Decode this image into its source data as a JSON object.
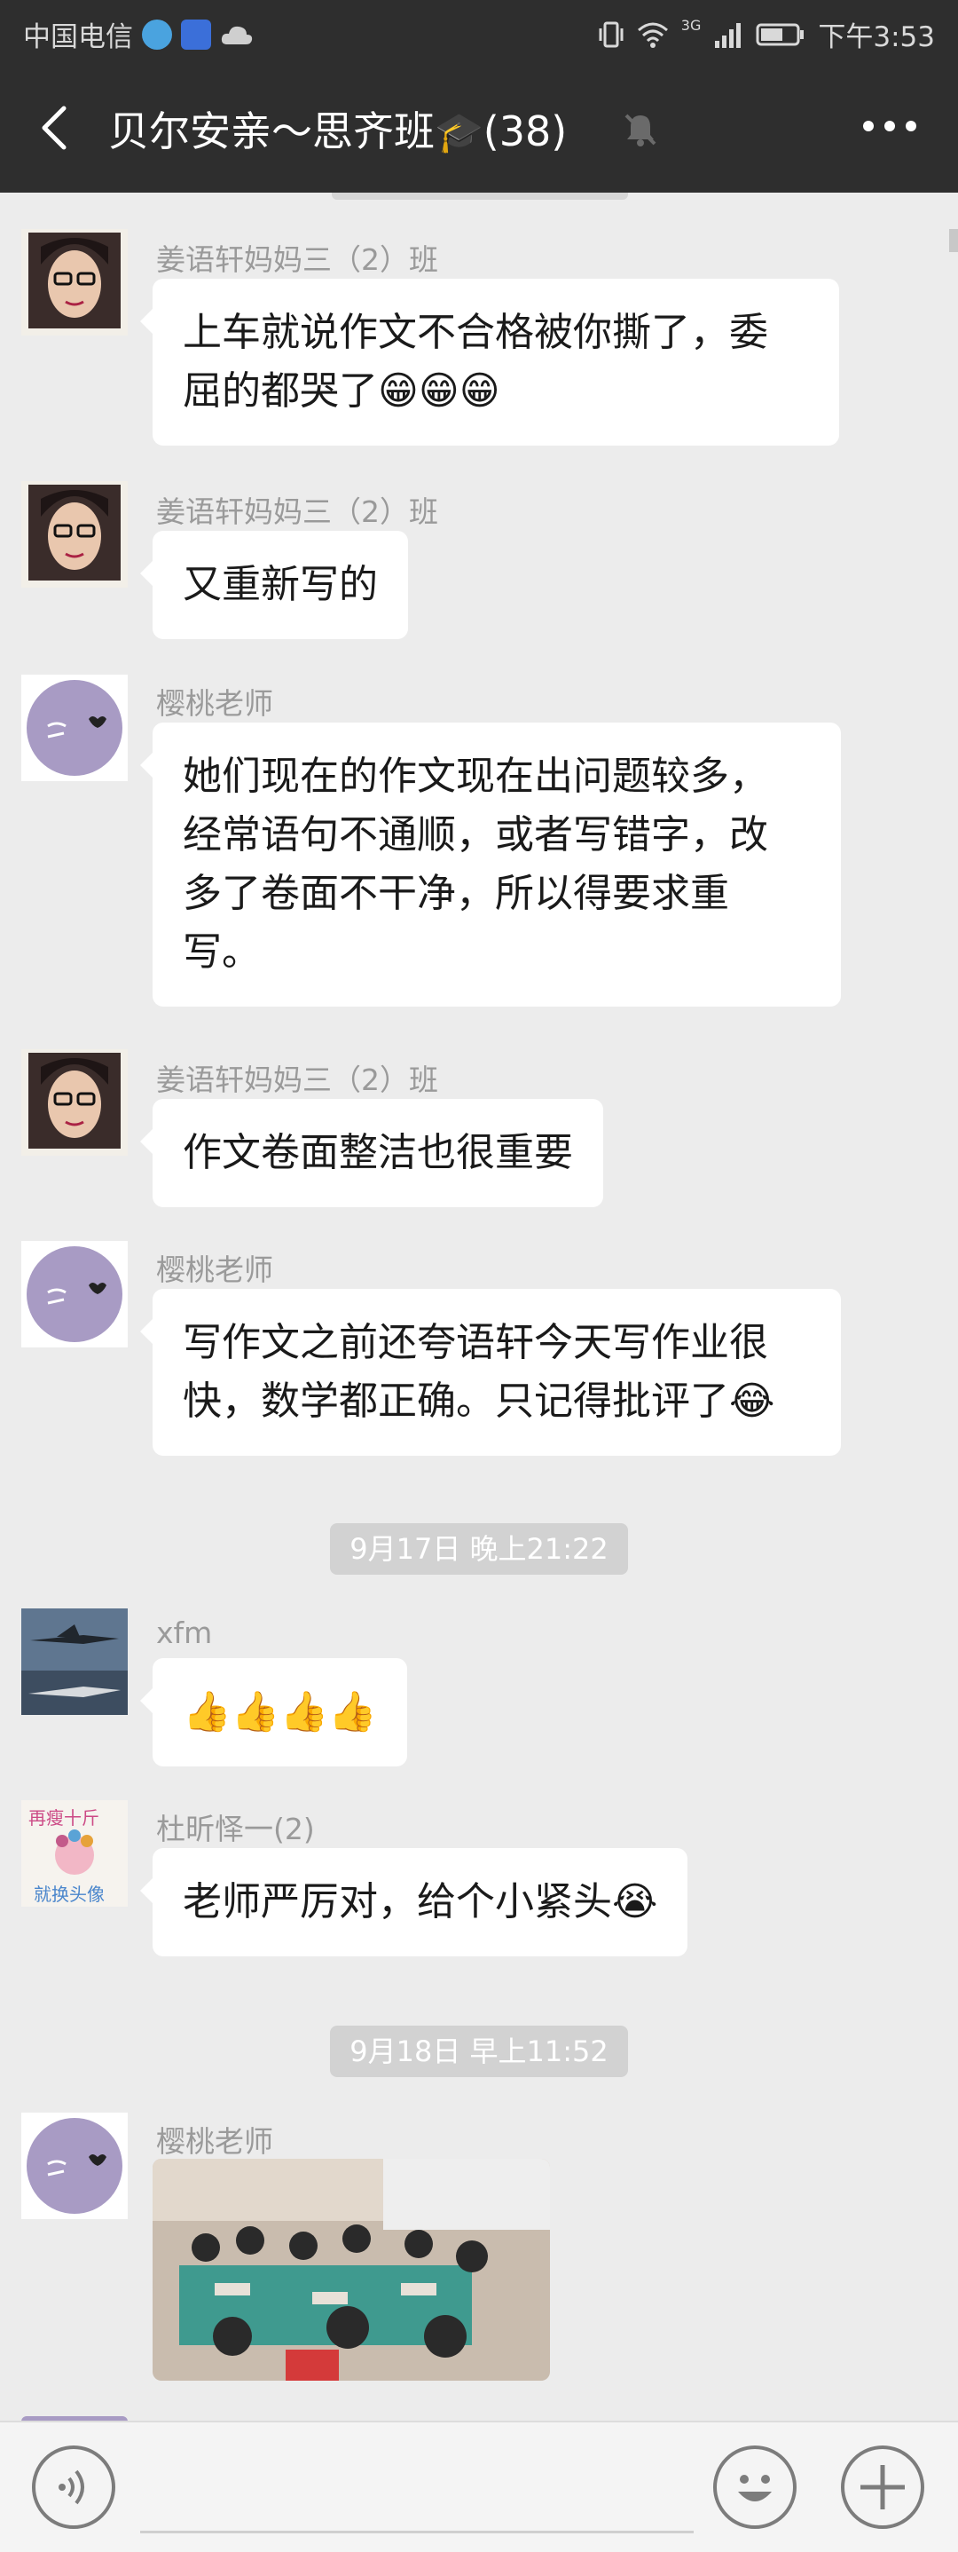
{
  "status_bar": {
    "carrier": "中国电信",
    "network": "3G",
    "time": "下午3:53"
  },
  "header": {
    "title": "贝尔安亲～思齐班",
    "title_emoji": "🎓",
    "member_count": "(38)"
  },
  "messages": [
    {
      "sender": "姜语轩妈妈三（2）班",
      "lines": [
        "上车就说作文不合格被你撕了，委",
        "屈的都哭了😁😁😁"
      ]
    },
    {
      "sender": "姜语轩妈妈三（2）班",
      "lines": [
        "又重新写的"
      ]
    },
    {
      "sender": "樱桃老师",
      "lines": [
        "她们现在的作文现在出问题较多，",
        "经常语句不通顺，或者写错字，改",
        "多了卷面不干净，所以得要求重",
        "写。"
      ]
    },
    {
      "sender": "姜语轩妈妈三（2）班",
      "lines": [
        "作文卷面整洁也很重要"
      ]
    },
    {
      "sender": "樱桃老师",
      "lines": [
        "写作文之前还夸语轩今天写作业很",
        "快，数学都正确。只记得批评了😂"
      ]
    },
    {
      "sender": "xfm",
      "lines": [
        "👍👍👍👍"
      ]
    },
    {
      "sender": "杜昕怿一(2)",
      "lines": [
        "老师严厉对，给个小紧头😭"
      ]
    },
    {
      "sender": "樱桃老师",
      "lines": []
    }
  ],
  "timestamps": [
    "9月17日 晚上21:22",
    "9月18日 早上11:52"
  ],
  "avatar_texts": {
    "dux_top": "再瘦十斤",
    "dux_bottom": "就换头像"
  },
  "colors": {
    "header_bg": "#2e2e2e",
    "chat_bg": "#ececec",
    "bubble": "#ffffff"
  },
  "icons": [
    "back-arrow-icon",
    "mute-bell-icon",
    "more-icon",
    "voice-icon",
    "emoji-icon",
    "plus-icon"
  ]
}
